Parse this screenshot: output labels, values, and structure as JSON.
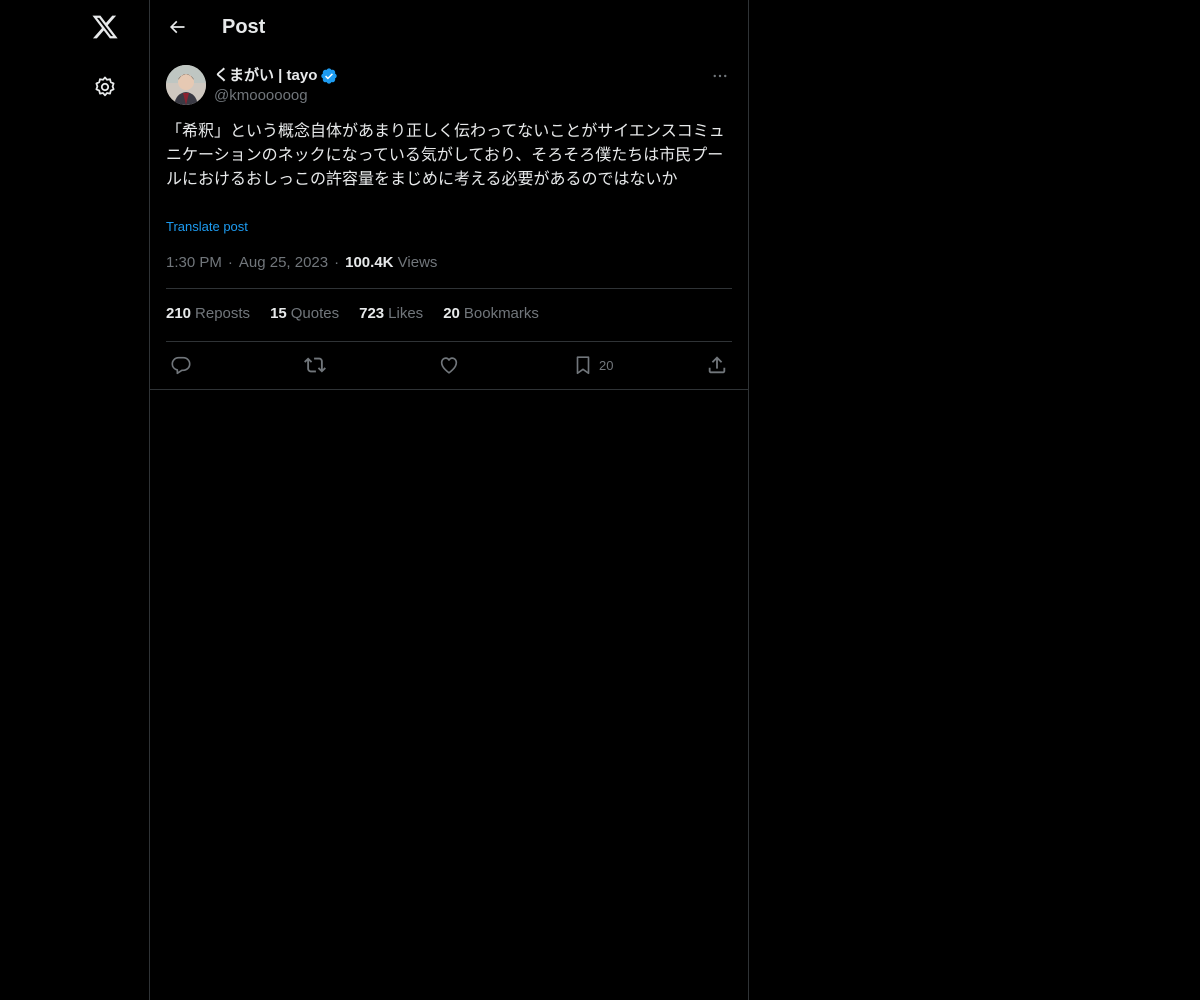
{
  "header": {
    "title": "Post"
  },
  "post": {
    "author_name": "くまがい | tayo",
    "author_handle": "@kmoooooog",
    "text": "「希釈」という概念自体があまり正しく伝わってないことがサイエンスコミュニケーションのネックになっている気がしており、そろそろ僕たちは市民プールにおけるおしっこの許容量をまじめに考える必要があるのではないか",
    "translate_label": "Translate post",
    "time": "1:30 PM",
    "date": "Aug 25, 2023",
    "views_count": "100.4K",
    "views_label": "Views"
  },
  "stats": {
    "reposts_count": "210",
    "reposts_label": "Reposts",
    "quotes_count": "15",
    "quotes_label": "Quotes",
    "likes_count": "723",
    "likes_label": "Likes",
    "bookmarks_count": "20",
    "bookmarks_label": "Bookmarks"
  },
  "actions": {
    "bookmark_count": "20"
  },
  "icons": {
    "logo": "x-logo-icon",
    "settings": "gear-icon",
    "back": "arrow-left-icon",
    "verified": "verified-badge-icon",
    "more": "more-horizontal-icon",
    "reply": "reply-icon",
    "repost": "repost-icon",
    "like": "heart-icon",
    "bookmark": "bookmark-icon",
    "share": "share-icon"
  },
  "colors": {
    "background": "#000000",
    "text_primary": "#e7e9ea",
    "text_secondary": "#71767b",
    "accent": "#1d9bf0",
    "border": "#2f3336"
  }
}
